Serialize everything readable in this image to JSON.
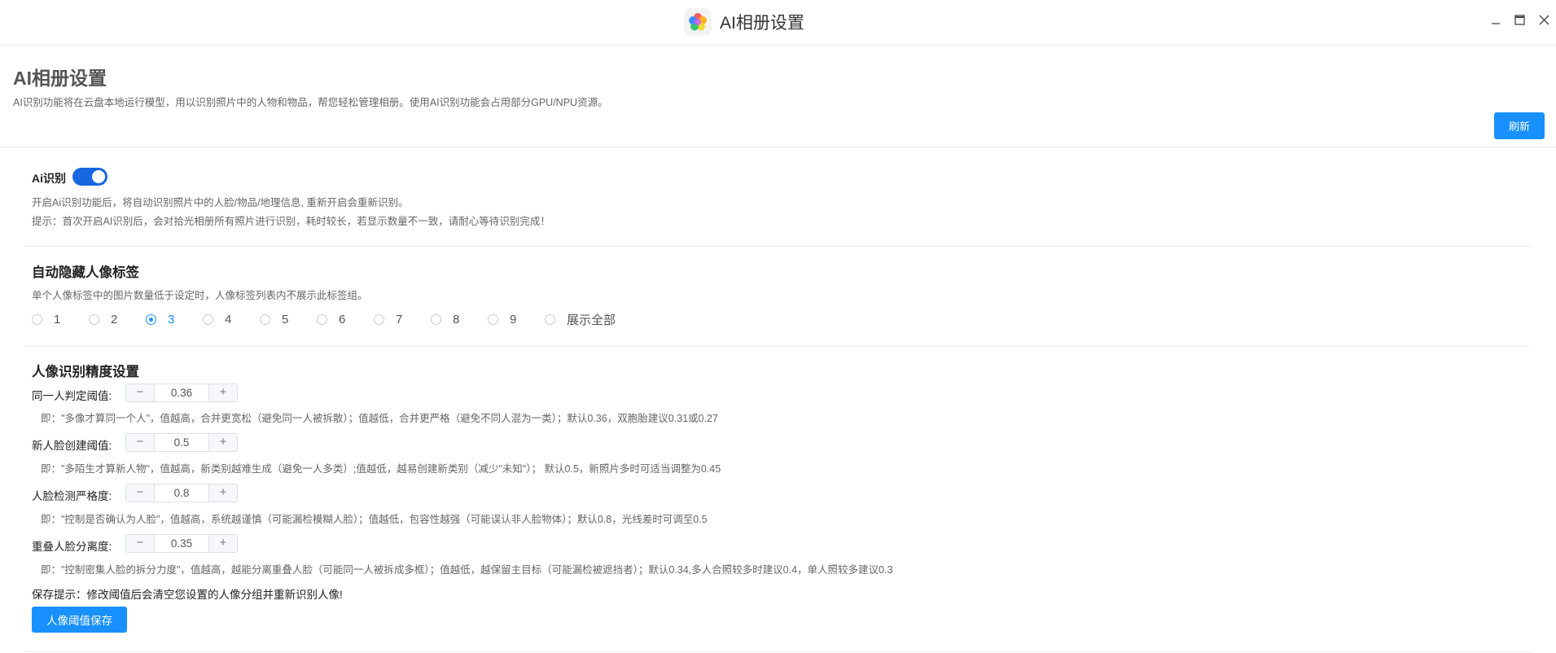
{
  "window": {
    "title": "AI相册设置",
    "icon": "photos-flower-icon",
    "controls": [
      "minimize-icon",
      "maximize-icon",
      "close-icon"
    ]
  },
  "header": {
    "title": "AI相册设置",
    "description": "AI识别功能将在云盘本地运行模型，用以识别照片中的人物和物品，帮您轻松管理相册。使用AI识别功能会占用部分GPU/NPU资源。",
    "refresh_label": "刷新"
  },
  "ai_recognition": {
    "label": "Ai识别",
    "enabled": true,
    "desc": "开启Ai识别功能后，将自动识别照片中的人脸/物品/地理信息, 重新开启会重新识别。",
    "tip": "提示：首次开启AI识别后，会对拾光相册所有照片进行识别，耗时较长，若显示数量不一致，请耐心等待识别完成！"
  },
  "auto_hide": {
    "title": "自动隐藏人像标签",
    "desc": "单个人像标签中的图片数量低于设定时，人像标签列表内不展示此标签组。",
    "options": [
      "1",
      "2",
      "3",
      "4",
      "5",
      "6",
      "7",
      "8",
      "9",
      "展示全部"
    ],
    "selected": "3"
  },
  "precision": {
    "title": "人像识别精度设置",
    "rows": [
      {
        "label": "同一人判定阈值:",
        "value": "0.36",
        "hint": "即：\"多像才算同一个人\"，值越高，合并更宽松（避免同一人被拆散）；值越低，合并更严格（避免不同人混为一类）；默认0.36，双胞胎建议0.31或0.27"
      },
      {
        "label": "新人脸创建阈值:",
        "value": "0.5",
        "hint": "即：\"多陌生才算新人物\"，值越高，新类别越难生成（避免一人多类）;值越低，越易创建新类别（减少\"未知\"）； 默认0.5，新照片多时可适当调整为0.45"
      },
      {
        "label": "人脸检测严格度:",
        "value": "0.8",
        "hint": "即：\"控制是否确认为人脸\"，值越高，系统越谨慎（可能漏检模糊人脸）；值越低，包容性越强（可能误认非人脸物体）；默认0.8，光线差时可调至0.5"
      },
      {
        "label": "重叠人脸分离度:",
        "value": "0.35",
        "hint": "即：\"控制密集人脸的拆分力度\"，值越高，越能分离重叠人脸（可能同一人被拆成多框）；值越低，越保留主目标（可能漏检被遮挡者）；默认0.34,多人合照较多时建议0.4，单人照较多建议0.3"
      }
    ],
    "save_tip": "保存提示：修改阈值后会清空您设置的人像分组并重新识别人像!",
    "save_label": "人像阈值保存"
  },
  "colors": {
    "primary": "#1890ff",
    "toggle_on": "#1667e0"
  }
}
